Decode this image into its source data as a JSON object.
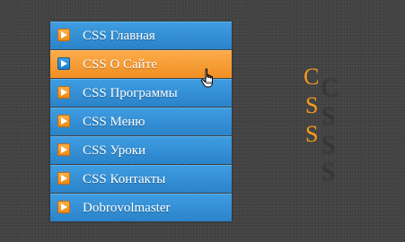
{
  "menu": {
    "items": [
      {
        "label": "CSS Главная",
        "active": false
      },
      {
        "label": "CSS О Сайте",
        "active": true
      },
      {
        "label": "CSS Программы",
        "active": false
      },
      {
        "label": "CSS Меню",
        "active": false
      },
      {
        "label": "CSS Уроки",
        "active": false
      },
      {
        "label": "CSS Контакты",
        "active": false
      },
      {
        "label": "Dobrovolmaster",
        "active": false
      }
    ]
  },
  "side_text": {
    "letters": [
      "C",
      "S",
      "S"
    ]
  },
  "colors": {
    "menu_blue": "#2d8ad3",
    "menu_orange": "#f79a2c",
    "side_text": "#f29a1e",
    "background": "#424242"
  },
  "icons": {
    "item_arrow": "play-arrow-icon",
    "cursor": "hand-pointer-icon"
  }
}
